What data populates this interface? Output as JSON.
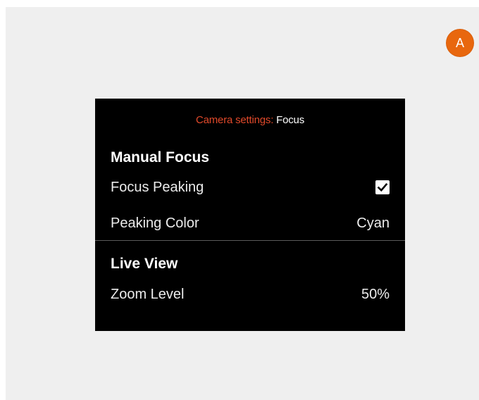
{
  "badge": {
    "label": "A"
  },
  "header": {
    "crumb": "Camera settings:",
    "current": "Focus"
  },
  "sections": {
    "manual_focus": {
      "title": "Manual Focus",
      "focus_peaking": {
        "label": "Focus Peaking",
        "checked": true
      },
      "peaking_color": {
        "label": "Peaking Color",
        "value": "Cyan"
      }
    },
    "live_view": {
      "title": "Live View",
      "zoom_level": {
        "label": "Zoom Level",
        "value": "50%"
      }
    }
  },
  "colors": {
    "accent": "#e8670e",
    "crumb": "#e0492a",
    "screen_bg": "#000000",
    "page_bg": "#efefef"
  },
  "icons": {
    "checkbox": "checkmark-icon"
  }
}
